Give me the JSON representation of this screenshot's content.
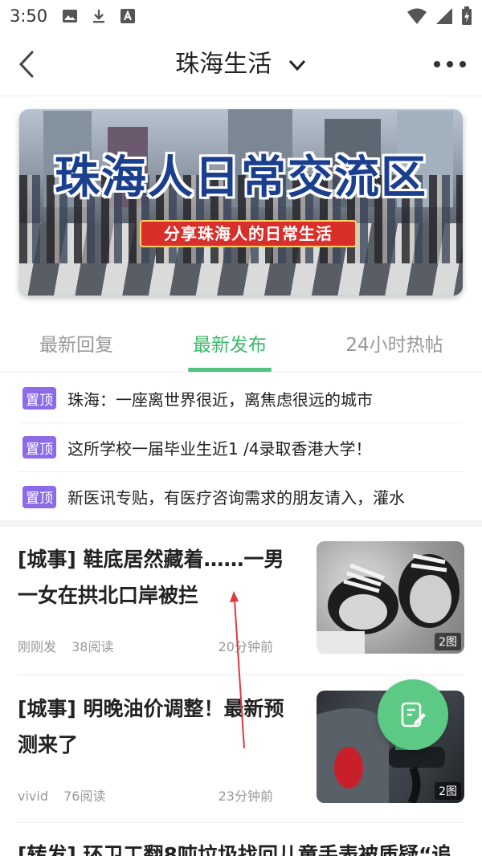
{
  "status_bar": {
    "time": "3:50"
  },
  "header": {
    "title": "珠海生活"
  },
  "banner": {
    "title": "珠海人日常交流区",
    "subtitle": "分享珠海人的日常生活"
  },
  "tabs": [
    {
      "label": "最新回复"
    },
    {
      "label": "最新发布"
    },
    {
      "label": "24小时热帖"
    }
  ],
  "pinned": {
    "badge": "置顶",
    "items": [
      {
        "text": "珠海：一座离世界很近，离焦虑很远的城市"
      },
      {
        "text": "这所学校一届毕业生近1 /4录取香港大学！"
      },
      {
        "text": "新医讯专贴，有医疗咨询需求的朋友请入，灌水"
      }
    ]
  },
  "feed": [
    {
      "title": "[城事] 鞋底居然藏着……一男一女在拱北口岸被拦",
      "author": "刚刚发",
      "reads": "38阅读",
      "time": "20分钟前",
      "image_count": "2图"
    },
    {
      "title": "[城事] 明晚油价调整！最新预测来了",
      "author": "vivid",
      "reads": "76阅读",
      "time": "23分钟前",
      "image_count": "2图"
    },
    {
      "title": "[转发] 环卫工翻8吨垃圾找回儿童手表被质疑“追"
    }
  ],
  "colors": {
    "accent": "#3cb96a",
    "pin_badge": "#8b6be8",
    "fab": "#5cc985"
  }
}
